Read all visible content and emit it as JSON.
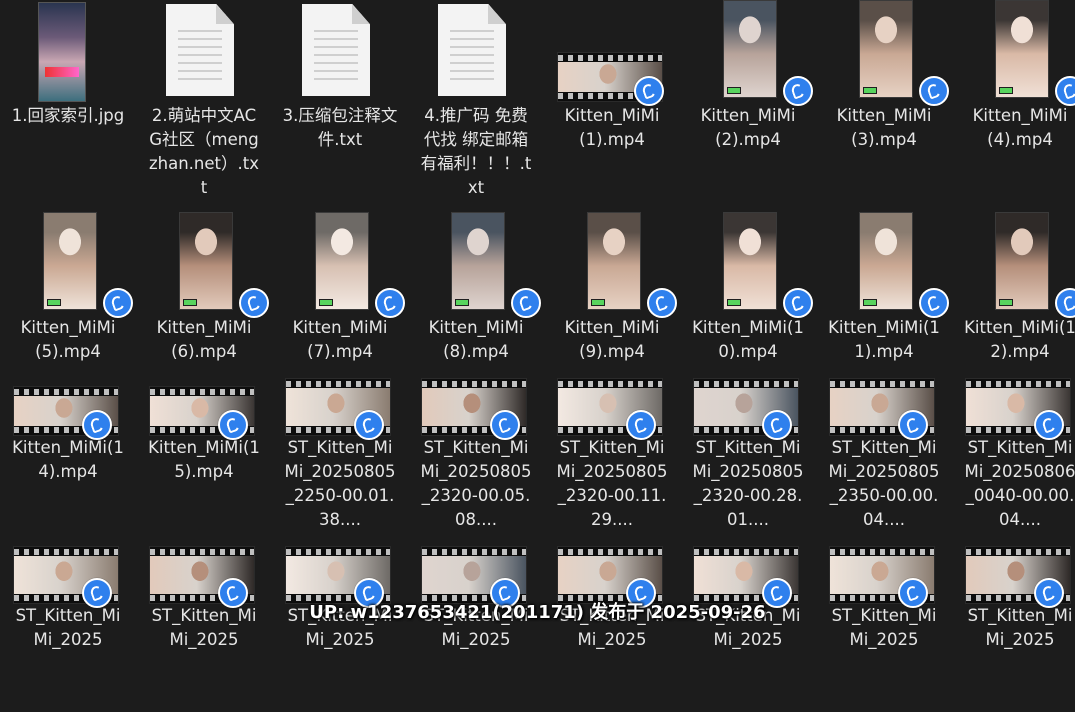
{
  "watermark": "UP: w1237653421(201171) 发布于 2025-09-26",
  "files": [
    {
      "name": "1.回家索引.jpg",
      "kind": "image",
      "thumb_icon": "image-thumbnail"
    },
    {
      "name": "2.萌站中文ACG社区（mengzhan.net）.txt",
      "kind": "text",
      "thumb_icon": "text-document-icon"
    },
    {
      "name": "3.压缩包注释文件.txt",
      "kind": "text",
      "thumb_icon": "text-document-icon"
    },
    {
      "name": "4.推广码 免费代找 绑定邮箱有福利！！！.txt",
      "kind": "text",
      "thumb_icon": "text-document-icon"
    },
    {
      "name": "Kitten_MiMi(1).mp4",
      "kind": "video-landscape",
      "thumb_icon": "video-thumbnail"
    },
    {
      "name": "Kitten_MiMi(2).mp4",
      "kind": "video-portrait",
      "thumb_icon": "video-thumbnail"
    },
    {
      "name": "Kitten_MiMi(3).mp4",
      "kind": "video-portrait",
      "thumb_icon": "video-thumbnail"
    },
    {
      "name": "Kitten_MiMi(4).mp4",
      "kind": "video-portrait",
      "thumb_icon": "video-thumbnail"
    },
    {
      "name": "Kitten_MiMi(5).mp4",
      "kind": "video-portrait",
      "thumb_icon": "video-thumbnail"
    },
    {
      "name": "Kitten_MiMi(6).mp4",
      "kind": "video-portrait",
      "thumb_icon": "video-thumbnail"
    },
    {
      "name": "Kitten_MiMi(7).mp4",
      "kind": "video-portrait",
      "thumb_icon": "video-thumbnail"
    },
    {
      "name": "Kitten_MiMi(8).mp4",
      "kind": "video-portrait",
      "thumb_icon": "video-thumbnail"
    },
    {
      "name": "Kitten_MiMi(9).mp4",
      "kind": "video-portrait",
      "thumb_icon": "video-thumbnail"
    },
    {
      "name": "Kitten_MiMi(10).mp4",
      "kind": "video-portrait",
      "thumb_icon": "video-thumbnail"
    },
    {
      "name": "Kitten_MiMi(11).mp4",
      "kind": "video-portrait",
      "thumb_icon": "video-thumbnail"
    },
    {
      "name": "Kitten_MiMi(12).mp4",
      "kind": "video-portrait",
      "thumb_icon": "video-thumbnail"
    },
    {
      "name": "Kitten_MiMi(14).mp4",
      "kind": "video-landscape",
      "thumb_icon": "video-thumbnail"
    },
    {
      "name": "Kitten_MiMi(15).mp4",
      "kind": "video-landscape",
      "thumb_icon": "video-thumbnail"
    },
    {
      "name": "ST_Kitten_MiMi_20250805_2250-00.01.38....",
      "kind": "video-landscape",
      "thumb_icon": "video-thumbnail"
    },
    {
      "name": "ST_Kitten_MiMi_20250805_2320-00.05.08....",
      "kind": "video-landscape",
      "thumb_icon": "video-thumbnail"
    },
    {
      "name": "ST_Kitten_MiMi_20250805_2320-00.11.29....",
      "kind": "video-landscape",
      "thumb_icon": "video-thumbnail"
    },
    {
      "name": "ST_Kitten_MiMi_20250805_2320-00.28.01....",
      "kind": "video-landscape",
      "thumb_icon": "video-thumbnail"
    },
    {
      "name": "ST_Kitten_MiMi_20250805_2350-00.00.04....",
      "kind": "video-landscape",
      "thumb_icon": "video-thumbnail"
    },
    {
      "name": "ST_Kitten_MiMi_20250806_0040-00.00.04....",
      "kind": "video-landscape",
      "thumb_icon": "video-thumbnail"
    },
    {
      "name": "ST_Kitten_MiMi_2025",
      "kind": "video-landscape",
      "thumb_icon": "video-thumbnail"
    },
    {
      "name": "ST_Kitten_MiMi_2025",
      "kind": "video-landscape",
      "thumb_icon": "video-thumbnail"
    },
    {
      "name": "ST_Kitten_MiMi_2025",
      "kind": "video-landscape",
      "thumb_icon": "video-thumbnail"
    },
    {
      "name": "ST_Kitten_MiMi_2025",
      "kind": "video-landscape",
      "thumb_icon": "video-thumbnail"
    },
    {
      "name": "ST_Kitten_MiMi_2025",
      "kind": "video-landscape",
      "thumb_icon": "video-thumbnail"
    },
    {
      "name": "ST_Kitten_MiMi_2025",
      "kind": "video-landscape",
      "thumb_icon": "video-thumbnail"
    },
    {
      "name": "ST_Kitten_MiMi_2025",
      "kind": "video-landscape",
      "thumb_icon": "video-thumbnail"
    },
    {
      "name": "ST_Kitten_MiMi_2025",
      "kind": "video-landscape",
      "thumb_icon": "video-thumbnail"
    }
  ],
  "overlay_icon": "sync-status-icon",
  "colors": {
    "background": "#1c1c1c",
    "text": "#e6e6e6",
    "badge": "#2f80ed"
  }
}
